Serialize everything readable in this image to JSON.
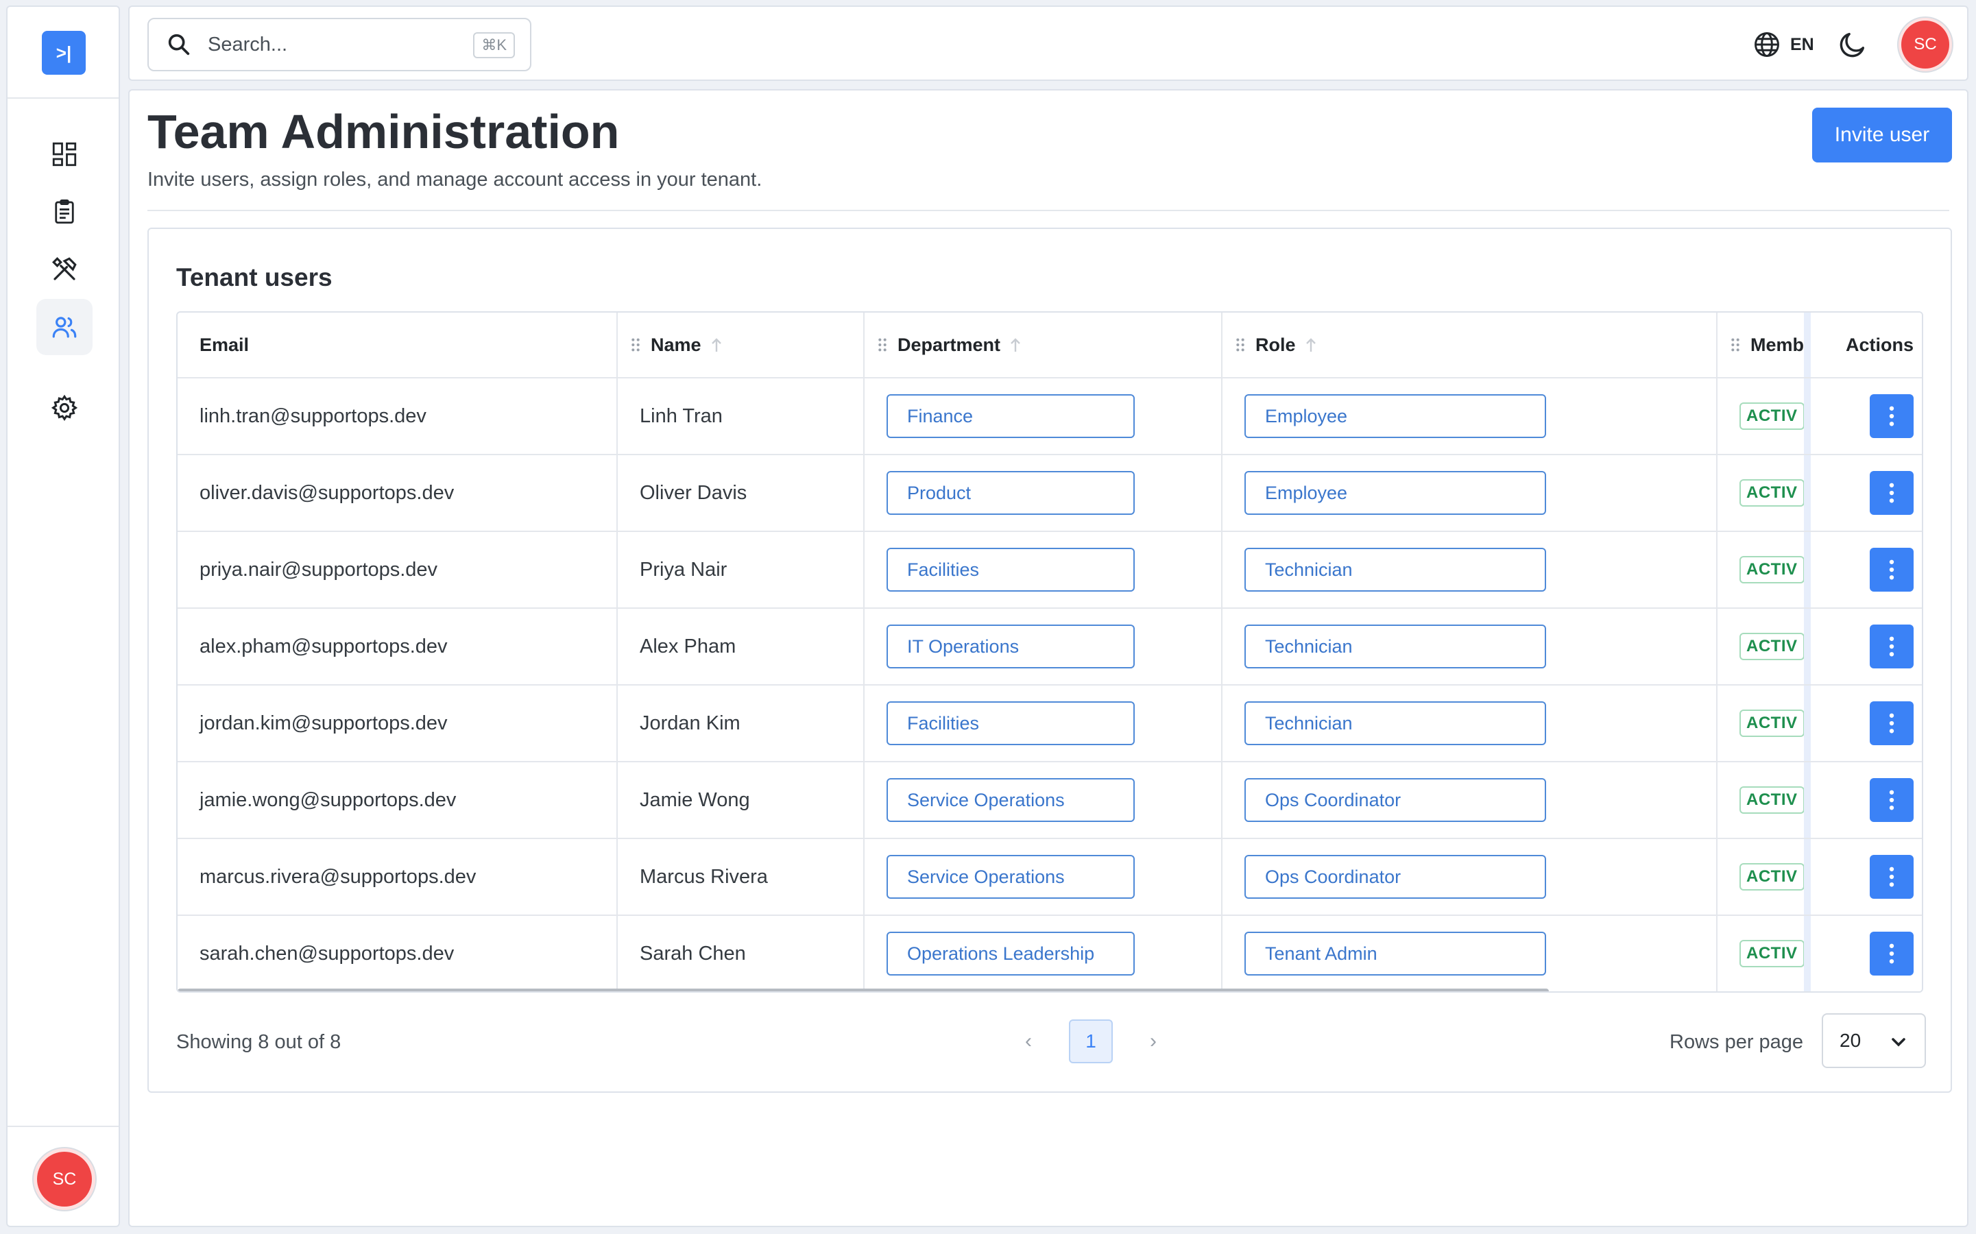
{
  "sidebar": {
    "toggle_label": ">|",
    "nav_icons": [
      "dashboard-icon",
      "clipboard-icon",
      "tools-icon",
      "users-icon",
      "gear-icon"
    ],
    "active_item": "users",
    "avatar_initials": "SC"
  },
  "header": {
    "search_placeholder": "Search...",
    "search_shortcut": "⌘K",
    "language": "EN",
    "avatar_initials": "SC"
  },
  "page": {
    "title": "Team Administration",
    "subtitle": "Invite users, assign roles, and manage account access in your tenant.",
    "invite_button": "Invite user"
  },
  "table": {
    "title": "Tenant users",
    "columns": {
      "email": "Email",
      "name": "Name",
      "department": "Department",
      "role": "Role",
      "membership": "Memb",
      "actions": "Actions"
    },
    "rows": [
      {
        "email": "linh.tran@supportops.dev",
        "name": "Linh Tran",
        "department": "Finance",
        "role": "Employee",
        "status": "ACTIV"
      },
      {
        "email": "oliver.davis@supportops.dev",
        "name": "Oliver Davis",
        "department": "Product",
        "role": "Employee",
        "status": "ACTIV"
      },
      {
        "email": "priya.nair@supportops.dev",
        "name": "Priya Nair",
        "department": "Facilities",
        "role": "Technician",
        "status": "ACTIV"
      },
      {
        "email": "alex.pham@supportops.dev",
        "name": "Alex Pham",
        "department": "IT Operations",
        "role": "Technician",
        "status": "ACTIV"
      },
      {
        "email": "jordan.kim@supportops.dev",
        "name": "Jordan Kim",
        "department": "Facilities",
        "role": "Technician",
        "status": "ACTIV"
      },
      {
        "email": "jamie.wong@supportops.dev",
        "name": "Jamie Wong",
        "department": "Service Operations",
        "role": "Ops Coordinator",
        "status": "ACTIV"
      },
      {
        "email": "marcus.rivera@supportops.dev",
        "name": "Marcus Rivera",
        "department": "Service Operations",
        "role": "Ops Coordinator",
        "status": "ACTIV"
      },
      {
        "email": "sarah.chen@supportops.dev",
        "name": "Sarah Chen",
        "department": "Operations Leadership",
        "role": "Tenant Admin",
        "status": "ACTIV"
      }
    ]
  },
  "footer": {
    "showing_text": "Showing 8 out of 8",
    "prev_symbol": "‹",
    "next_symbol": "›",
    "current_page": "1",
    "rows_per_page_label": "Rows per page",
    "rows_per_page_value": "20"
  },
  "colors": {
    "accent": "#3b82f6",
    "avatar": "#ef4444",
    "status_active": "#1e8f4e"
  }
}
